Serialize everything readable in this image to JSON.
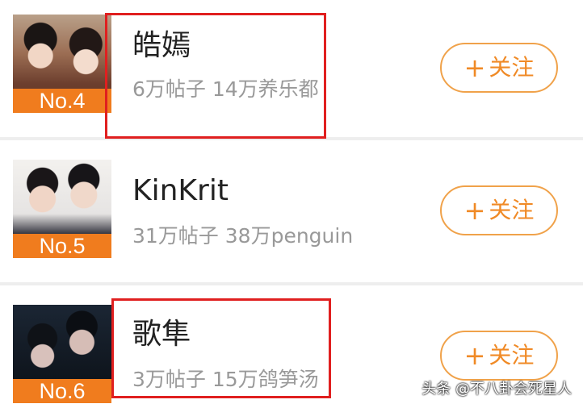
{
  "items": [
    {
      "rank": "No.4",
      "name": "皓嫣",
      "stats": "6万帖子 14万养乐都",
      "follow": "关注"
    },
    {
      "rank": "No.5",
      "name": "KinKrit",
      "stats": "31万帖子 38万penguin",
      "follow": "关注"
    },
    {
      "rank": "No.6",
      "name": "歌隼",
      "stats": "3万帖子 15万鸽笋汤",
      "follow": "关注"
    }
  ],
  "watermark": "头条 @不八卦会死星人",
  "colors": {
    "accent": "#f07c1e",
    "highlight": "#e01f1f"
  }
}
